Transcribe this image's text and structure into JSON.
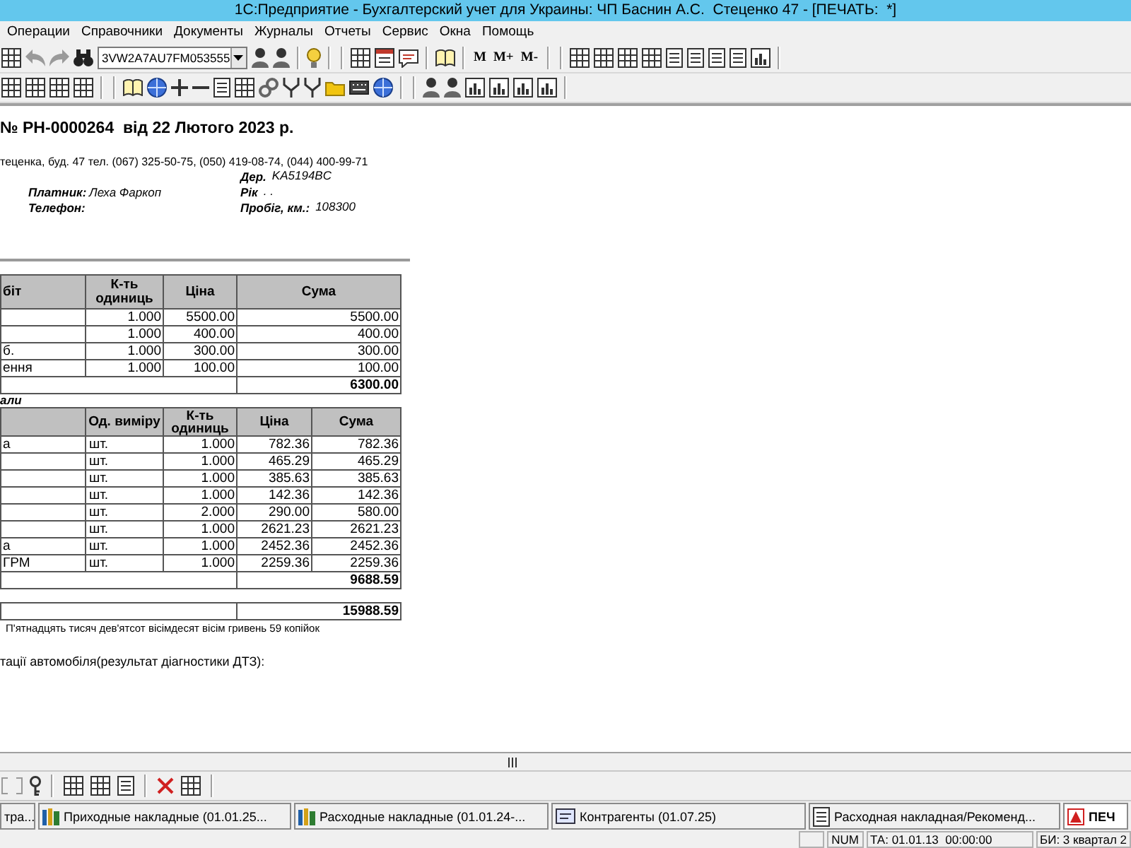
{
  "window": {
    "title": "1С:Предприятие - Бухгалтерский учет для Украины: ЧП Баснин А.С.  Стеценко 47 - [ПЕЧАТЬ:  *]"
  },
  "menu": [
    "Операции",
    "Справочники",
    "Документы",
    "Журналы",
    "Отчеты",
    "Сервис",
    "Окна",
    "Помощь"
  ],
  "toolbar": {
    "search_value": "3VW2A7AU7FM053555",
    "memory_buttons": [
      "M",
      "M+",
      "M-"
    ]
  },
  "document": {
    "title": "№ РН-0000264  від 22 Лютого 2023 р.",
    "address": "теценка, буд. 47 тел. (067) 325-50-75, (050) 419-08-74, (044) 400-99-71",
    "client_fields": [
      {
        "label": "Платник:",
        "value": "Леха Фаркоп"
      },
      {
        "label": "Телефон:"
      }
    ],
    "vehicle_fields": [
      {
        "label": "Дер.",
        "value": "KA5194BC"
      },
      {
        "label": "Рік",
        "value": ". ."
      },
      {
        "label": "Пробіг, км.:",
        "value": "108300"
      }
    ],
    "works_table": {
      "columns": [
        "біт",
        "К-ть одиниць",
        "Ціна",
        "Сума"
      ],
      "rows": [
        {
          "qty": "1.000",
          "price": "5500.00",
          "sum": "5500.00"
        },
        {
          "qty": "1.000",
          "price": "400.00",
          "sum": "400.00"
        },
        {
          "name": "б.",
          "qty": "1.000",
          "price": "300.00",
          "sum": "300.00"
        },
        {
          "name": "ення",
          "qty": "1.000",
          "price": "100.00",
          "sum": "100.00"
        }
      ],
      "total": "6300.00"
    },
    "parts_heading": "али",
    "parts_table": {
      "columns": [
        "Од. виміру",
        "К-ть одиниць",
        "Ціна",
        "Сума"
      ],
      "rows": [
        {
          "name": "а",
          "unit": "шт.",
          "qty": "1.000",
          "price": "782.36",
          "sum": "782.36"
        },
        {
          "unit": "шт.",
          "qty": "1.000",
          "price": "465.29",
          "sum": "465.29"
        },
        {
          "unit": "шт.",
          "qty": "1.000",
          "price": "385.63",
          "sum": "385.63"
        },
        {
          "unit": "шт.",
          "qty": "1.000",
          "price": "142.36",
          "sum": "142.36"
        },
        {
          "unit": "шт.",
          "qty": "2.000",
          "price": "290.00",
          "sum": "580.00"
        },
        {
          "unit": "шт.",
          "qty": "1.000",
          "price": "2621.23",
          "sum": "2621.23"
        },
        {
          "name": "а",
          "unit": "шт.",
          "qty": "1.000",
          "price": "2452.36",
          "sum": "2452.36"
        },
        {
          "name": "ГРМ",
          "unit": "шт.",
          "qty": "1.000",
          "price": "2259.36",
          "sum": "2259.36"
        }
      ],
      "total": "9688.59"
    },
    "grand_total": "15988.59",
    "amount_in_words": "П'ятнадцять тисяч дев'ятсот вісімдесят вісім гривень 59 копійок",
    "note": "тації автомобіля(результат діагностики ДТЗ):"
  },
  "window_tabs": [
    {
      "label": "тра...",
      "selected": false
    },
    {
      "label": "Приходные накладные (01.01.25...",
      "kind": "journal",
      "selected": false
    },
    {
      "label": "Расходные накладные (01.01.24-...",
      "kind": "journal",
      "selected": false
    },
    {
      "label": "Контрагенты (01.07.25)",
      "kind": "catalog",
      "selected": false
    },
    {
      "label": "Расходная накладная/Рекоменд...",
      "kind": "document",
      "selected": false
    },
    {
      "label": "ПЕЧ",
      "kind": "print",
      "selected": true
    }
  ],
  "status_bar": [
    "NUM",
    "ТА: 01.01.13  00:00:00",
    "БИ: 3 квартал 2"
  ]
}
